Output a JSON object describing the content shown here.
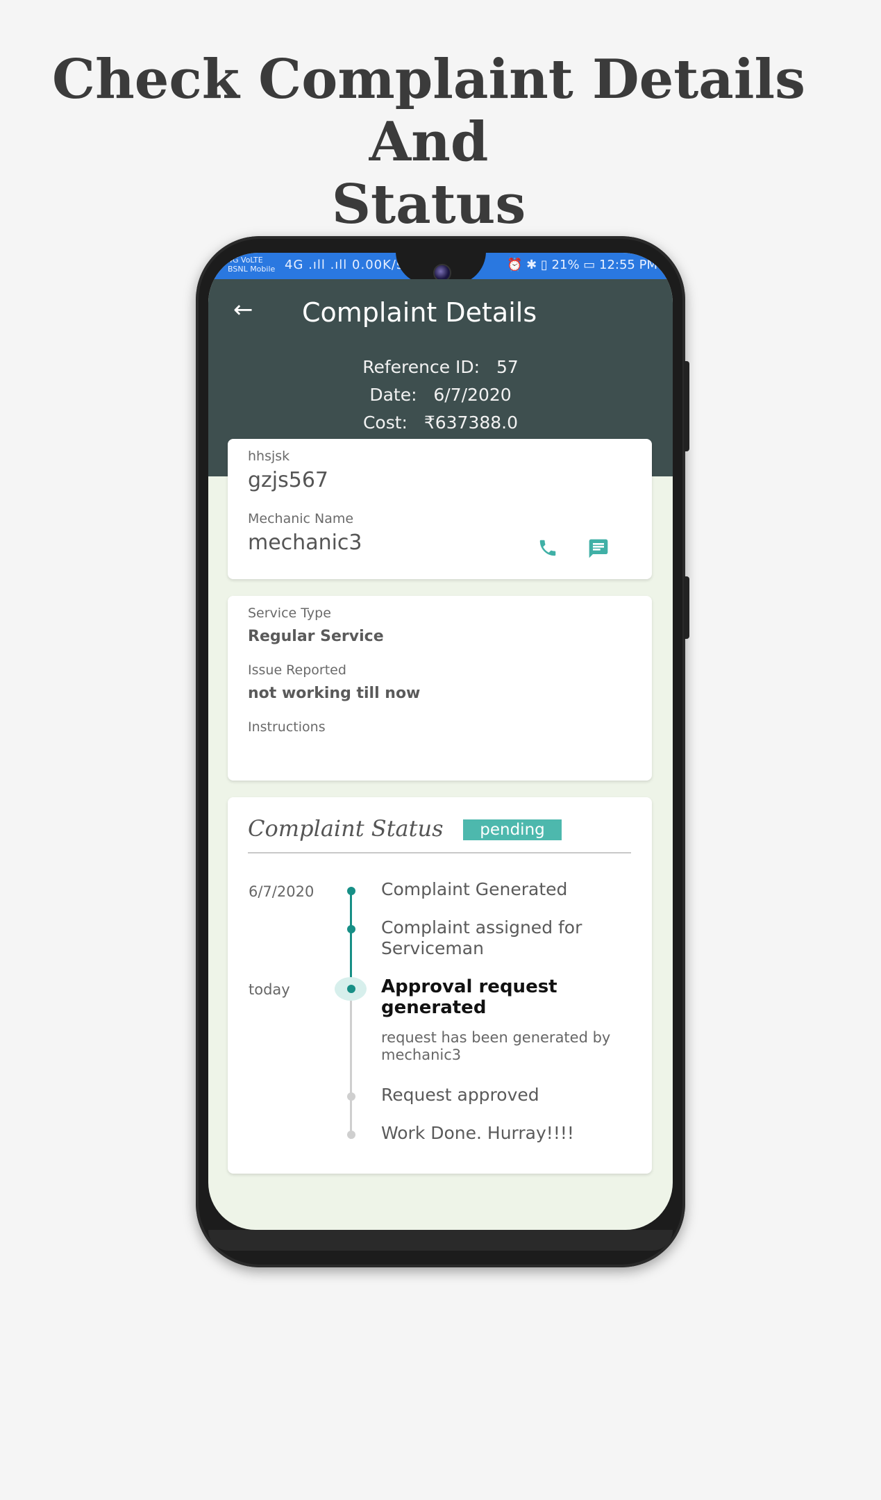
{
  "headline": {
    "line1": "Check Complaint Details And",
    "line2": "Status"
  },
  "statusbar": {
    "carrier_top": "4G VoLTE",
    "carrier_name": "BSNL Mobile",
    "network": "4G .ıll  .ıll  0.00K/s",
    "right": "⏰ ✱ ▯ 21%  ▭  12:55 PM"
  },
  "appbar": {
    "back_icon": "←",
    "title": "Complaint Details",
    "reference_label": "Reference ID:",
    "reference_value": "57",
    "date_label": "Date:",
    "date_value": "6/7/2020",
    "cost_label": "Cost:",
    "cost_value": "₹637388.0"
  },
  "vehicle_card": {
    "vehicle_label": "hhsjsk",
    "vehicle_value": "gzjs567",
    "mechanic_label": "Mechanic Name",
    "mechanic_value": "mechanic3",
    "call_icon": "✆",
    "message_icon": "▤"
  },
  "service_card": {
    "service_type_label": "Service Type",
    "service_type_value": "Regular Service",
    "issue_label": "Issue Reported",
    "issue_value": "not working till now",
    "instructions_label": "Instructions",
    "instructions_value": ""
  },
  "status_card": {
    "title": "Complaint Status",
    "badge": "pending",
    "badge_color": "#4db8ad",
    "timeline": [
      {
        "date": "6/7/2020",
        "text": "Complaint Generated",
        "state": "done"
      },
      {
        "date": "",
        "text": "Complaint assigned for Serviceman",
        "state": "done"
      },
      {
        "date": "today",
        "text": "Approval request generated",
        "sub": "request has been generated by mechanic3",
        "state": "current"
      },
      {
        "date": "",
        "text": "Request approved",
        "state": "todo"
      },
      {
        "date": "",
        "text": "Work Done. Hurray!!!!",
        "state": "todo"
      }
    ]
  },
  "colors": {
    "appbar": "#3e4f4f",
    "statusbar": "#2a78e0",
    "accent": "#178f86",
    "background": "#eef4e8"
  }
}
